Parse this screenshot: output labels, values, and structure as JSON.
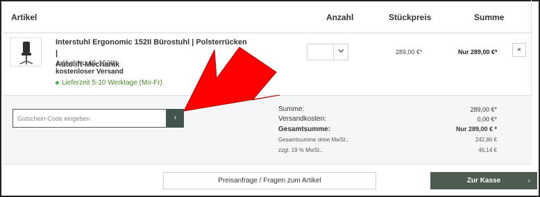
{
  "table_header": {
    "artikel": "Artikel",
    "anzahl": "Anzahl",
    "stueckpreis": "Stückpreis",
    "summe": "Summe"
  },
  "item": {
    "name_line1": "Interstuhl Ergonomic 152II Bürostuhl | Polsterrücken |",
    "name_line2": "Autolift-Mechanik",
    "article_number": "Artikel-Nr.: IS-152II",
    "shipping": "kostenloser Versand",
    "delivery": "Lieferzeit 5-10 Werktage (Mo-Fr)",
    "unit_price": "289,00 €*",
    "total": "Nur 289,00 €*",
    "remove_label": "×"
  },
  "coupon": {
    "placeholder": "Gutschein-Code eingeben",
    "submit_label": "›"
  },
  "totals": {
    "subtotal_label": "Summe:",
    "subtotal_value": "289,00 €*",
    "shipping_label": "Versandkosten:",
    "shipping_value": "0,00 €*",
    "grand_label": "Gesamtsumme:",
    "grand_value": "Nur 289,00 € *",
    "net_label": "Gesamtsumme ohne MwSt.:",
    "net_value": "242,86 €",
    "vat_label": "zzgl. 19 % MwSt.:",
    "vat_value": "46,14 €"
  },
  "actions": {
    "request_label": "Preisanfrage / Fragen zum Artikel",
    "checkout_label": "Zur Kasse",
    "checkout_arrow": "›"
  },
  "icons": {
    "product": "office-chair-image",
    "quantity": "chevron-down-icon",
    "remove": "close-icon",
    "annotation": "red-arrow-annotation"
  },
  "colors": {
    "accent": "#42554c",
    "checkout": "#4d5b51",
    "delivery": "#4a8a2a",
    "annotation": "#ff0000"
  }
}
